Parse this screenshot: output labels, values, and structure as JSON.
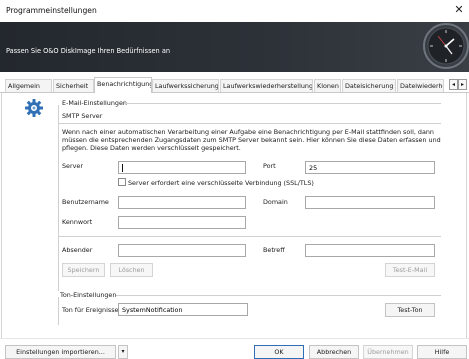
{
  "window": {
    "title": "Programmeinstellungen",
    "close_label": "✕"
  },
  "header": {
    "subtitle": "Passen Sie O&O DiskImage Ihren Bedürfnissen an",
    "clock_icon": "clock-icon"
  },
  "tabs": [
    {
      "label": "Allgemein",
      "active": false
    },
    {
      "label": "Sicherheit",
      "active": false
    },
    {
      "label": "Benachrichtigung",
      "active": true
    },
    {
      "label": "Laufwerkssicherung",
      "active": false
    },
    {
      "label": "Laufwerkswiederherstellung",
      "active": false
    },
    {
      "label": "Klonen",
      "active": false
    },
    {
      "label": "Dateisicherung",
      "active": false
    },
    {
      "label": "Dateiwiederhe",
      "active": false
    }
  ],
  "tab_scroll": {
    "left": "◂",
    "right": "▸"
  },
  "email": {
    "group_title": "E-Mail-Einstellungen",
    "smtp_title": "SMTP Server",
    "description_line1": "Wenn nach einer automatischen Verarbeitung einer Aufgabe eine Benachrichtigung per E-Mail stattfinden soll, dann",
    "description_line2": "müssen die entsprechenden Zugangsdaten zum SMTP Server bekannt sein. Hier können Sie diese Daten erfassen und",
    "description_line3": "pflegen. Diese Daten werden verschlüsselt gespeichert.",
    "server_label": "Server",
    "server_value": "",
    "port_label": "Port",
    "port_value": "25",
    "ssl_label": "Server erfordert eine verschlüsselte Verbindung (SSL/TLS)",
    "ssl_checked": false,
    "username_label": "Benutzername",
    "username_value": "",
    "domain_label": "Domain",
    "domain_value": "",
    "password_label": "Kennwort",
    "password_value": "",
    "sender_label": "Absender",
    "sender_value": "",
    "subject_label": "Betreff",
    "subject_value": "",
    "save_button": "Speichern",
    "delete_button": "Löschen",
    "test_email_button": "Test-E-Mail"
  },
  "sound": {
    "group_title": "Ton-Einstellungen",
    "events_label": "Ton für Ereignisse",
    "events_value": "SystemNotification",
    "test_sound_button": "Test-Ton"
  },
  "footer": {
    "import_button": "Einstellungen importieren...",
    "dropdown_arrow": "▾",
    "ok_button": "OK",
    "cancel_button": "Abbrechen",
    "apply_button": "Übernehmen",
    "help_button": "Hilfe"
  },
  "colors": {
    "header_bg": "#2c3138",
    "accent": "#2f6fb5"
  }
}
